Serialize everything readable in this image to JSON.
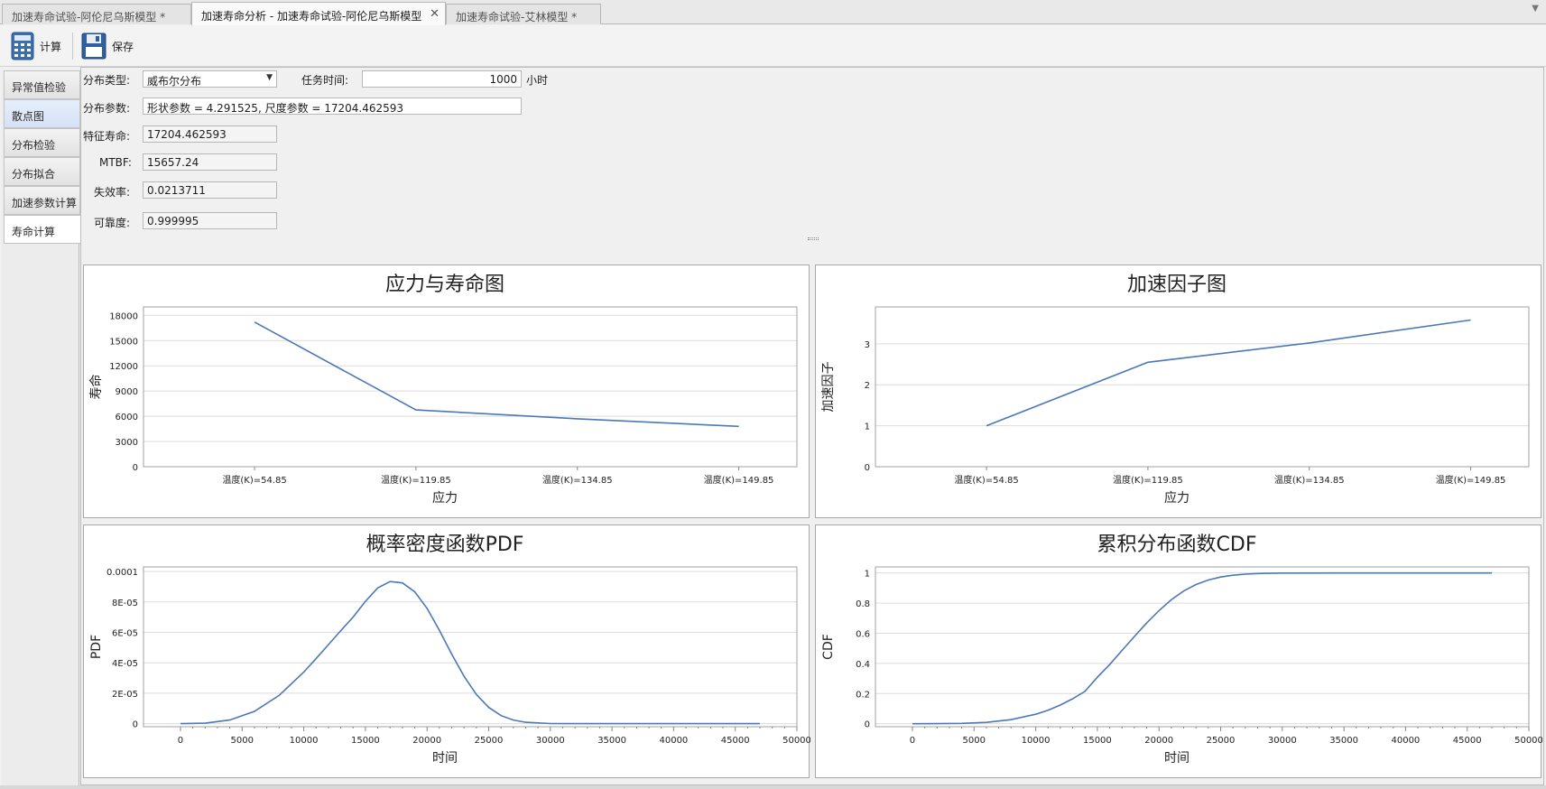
{
  "tabs": [
    {
      "label": "加速寿命试验-阿伦尼乌斯模型 *",
      "active": false
    },
    {
      "label": "加速寿命分析 - 加速寿命试验-阿伦尼乌斯模型",
      "active": true,
      "close": "✕"
    },
    {
      "label": "加速寿命试验-艾林模型 *",
      "active": false
    }
  ],
  "toolbar": {
    "calculate_label": "计算",
    "save_label": "保存"
  },
  "sidebar": {
    "items": [
      {
        "label": "异常值检验"
      },
      {
        "label": "散点图"
      },
      {
        "label": "分布检验"
      },
      {
        "label": "分布拟合"
      },
      {
        "label": "加速参数计算"
      },
      {
        "label": "寿命计算"
      }
    ]
  },
  "form": {
    "dist_type_label": "分布类型:",
    "dist_type_value": "威布尔分布",
    "mission_time_label": "任务时间:",
    "mission_time_value": "1000",
    "mission_time_unit": "小时",
    "dist_params_label": "分布参数:",
    "dist_params_value": "形状参数 = 4.291525, 尺度参数 = 17204.462593",
    "char_life_label": "特征寿命:",
    "char_life_value": "17204.462593",
    "mtbf_label": "MTBF:",
    "mtbf_value": "15657.24",
    "failure_rate_label": "失效率:",
    "failure_rate_value": "0.0213711",
    "reliability_label": "可靠度:",
    "reliability_value": "0.999995"
  },
  "chart_data": [
    {
      "type": "line",
      "title": "应力与寿命图",
      "xlabel": "应力",
      "ylabel": "寿命",
      "categories": [
        "温度(K)=54.85",
        "温度(K)=119.85",
        "温度(K)=134.85",
        "温度(K)=149.85"
      ],
      "values": [
        17200,
        6750,
        5700,
        4800
      ],
      "yticks": [
        "0",
        "3000",
        "6000",
        "9000",
        "12000",
        "15000",
        "18000"
      ],
      "ylim": [
        0,
        19000
      ],
      "grid": true,
      "color": "#4a78b8"
    },
    {
      "type": "line",
      "title": "加速因子图",
      "xlabel": "应力",
      "ylabel": "加速因子",
      "categories": [
        "温度(K)=54.85",
        "温度(K)=119.85",
        "温度(K)=134.85",
        "温度(K)=149.85"
      ],
      "values": [
        1.0,
        2.55,
        3.02,
        3.58
      ],
      "yticks": [
        "0",
        "1",
        "2",
        "3"
      ],
      "ylim": [
        0,
        3.9
      ],
      "grid": true,
      "color": "#4a78b8"
    },
    {
      "type": "line",
      "title": "概率密度函数PDF",
      "xlabel": "时间",
      "ylabel": "PDF",
      "x": [
        0,
        2000,
        4000,
        6000,
        8000,
        10000,
        11000,
        12000,
        13000,
        14000,
        15000,
        16000,
        17000,
        18000,
        19000,
        20000,
        21000,
        22000,
        23000,
        24000,
        25000,
        26000,
        27000,
        28000,
        30000,
        35000,
        40000,
        47000
      ],
      "values": [
        0,
        3e-07,
        2.4e-06,
        8.1e-06,
        1.86e-05,
        3.39e-05,
        4.27e-05,
        5.19e-05,
        6.11e-05,
        7e-05,
        8.04e-05,
        8.92e-05,
        9.34e-05,
        9.25e-05,
        8.67e-05,
        7.58e-05,
        6.14e-05,
        4.57e-05,
        3.11e-05,
        1.92e-05,
        1.07e-05,
        5.3e-06,
        2.4e-06,
        9e-07,
        1e-07,
        0,
        0,
        0
      ],
      "yticks": [
        "0",
        "2E-05",
        "4E-05",
        "6E-05",
        "8E-05",
        "0.0001"
      ],
      "xticks": [
        "0",
        "5000",
        "10000",
        "15000",
        "20000",
        "25000",
        "30000",
        "35000",
        "40000",
        "45000",
        "50000"
      ],
      "xlim": [
        -3000,
        50000
      ],
      "ylim": [
        -2e-06,
        0.000103
      ],
      "grid": true,
      "color": "#4a78b8"
    },
    {
      "type": "line",
      "title": "累积分布函数CDF",
      "xlabel": "时间",
      "ylabel": "CDF",
      "x": [
        0,
        2000,
        4000,
        6000,
        8000,
        10000,
        11000,
        12000,
        13000,
        14000,
        15000,
        16000,
        17000,
        18000,
        19000,
        20000,
        21000,
        22000,
        23000,
        24000,
        25000,
        26000,
        27000,
        28000,
        30000,
        35000,
        40000,
        47000
      ],
      "values": [
        0,
        0.0002,
        0.0019,
        0.0089,
        0.0268,
        0.0625,
        0.0897,
        0.124,
        0.1655,
        0.215,
        0.308,
        0.392,
        0.486,
        0.578,
        0.668,
        0.75,
        0.822,
        0.88,
        0.923,
        0.953,
        0.973,
        0.985,
        0.992,
        0.996,
        0.999,
        1,
        1,
        1
      ],
      "yticks": [
        "0",
        "0.2",
        "0.4",
        "0.6",
        "0.8",
        "1"
      ],
      "xticks": [
        "0",
        "5000",
        "10000",
        "15000",
        "20000",
        "25000",
        "30000",
        "35000",
        "40000",
        "45000",
        "50000"
      ],
      "xlim": [
        -3000,
        50000
      ],
      "ylim": [
        -0.02,
        1.04
      ],
      "grid": true,
      "color": "#4a78b8"
    }
  ]
}
